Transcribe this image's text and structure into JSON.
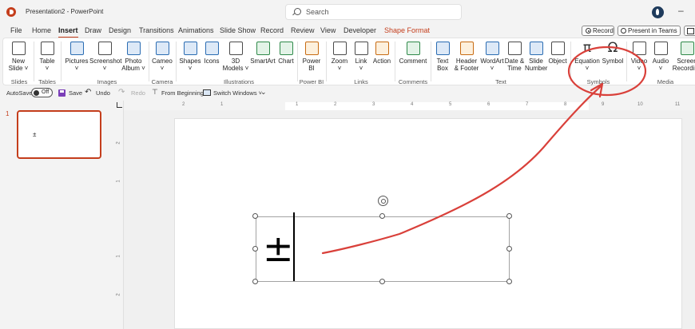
{
  "titlebar": {
    "title": "Presentation2 - PowerPoint",
    "search_placeholder": "Search"
  },
  "tabs": [
    "File",
    "Home",
    "Insert",
    "Draw",
    "Design",
    "Transitions",
    "Animations",
    "Slide Show",
    "Record",
    "Review",
    "View",
    "Developer",
    "Shape Format"
  ],
  "active_tab": "Insert",
  "header_buttons": {
    "record": "Record",
    "present": "Present in Teams"
  },
  "ribbon": {
    "buttons": {
      "new_slide": "New\nSlide ˅",
      "table": "Table\n˅",
      "pictures": "Pictures\n˅",
      "screenshot": "Screenshot\n˅",
      "photo_album": "Photo\nAlbum ˅",
      "cameo": "Cameo\n˅",
      "shapes": "Shapes\n˅",
      "icons": "Icons",
      "models_3d": "3D\nModels ˅",
      "smartart": "SmartArt",
      "chart": "Chart",
      "power_bi": "Power\nBI",
      "zoom": "Zoom\n˅",
      "link": "Link\n˅",
      "action": "Action",
      "comment": "Comment",
      "text_box": "Text\nBox",
      "header_footer": "Header\n& Footer",
      "wordart": "WordArt\n˅",
      "date_time": "Date &\nTime",
      "slide_number": "Slide\nNumber",
      "object": "Object",
      "equation": "Equation\n˅",
      "symbol": "Symbol",
      "video": "Video\n˅",
      "audio": "Audio\n˅",
      "screen_recording": "Screen\nRecording"
    },
    "groups": {
      "slides": "Slides",
      "tables": "Tables",
      "images": "Images",
      "camera": "Camera",
      "illustrations": "Illustrations",
      "power_bi": "Power BI",
      "links": "Links",
      "comments": "Comments",
      "text": "Text",
      "symbols": "Symbols",
      "media": "Media"
    }
  },
  "qat": {
    "autosave": "AutoSave",
    "toggle": "Off",
    "save": "Save",
    "undo": "Undo",
    "redo": "Redo",
    "from_beginning": "From Beginning",
    "switch_windows": "Switch Windows ˅"
  },
  "slides_panel": {
    "slide_number": "1",
    "thumb_text": "±"
  },
  "slide": {
    "symbol_text": "±"
  },
  "ruler": {
    "h": [
      "2",
      "1",
      "",
      "1",
      "2",
      "3",
      "4",
      "5",
      "6",
      "7",
      "8",
      "9",
      "10",
      "11"
    ],
    "v": [
      "2",
      "1",
      "",
      "1",
      "2"
    ]
  },
  "colors": {
    "accent": "#c43e1c",
    "annotation": "#d9403a"
  }
}
